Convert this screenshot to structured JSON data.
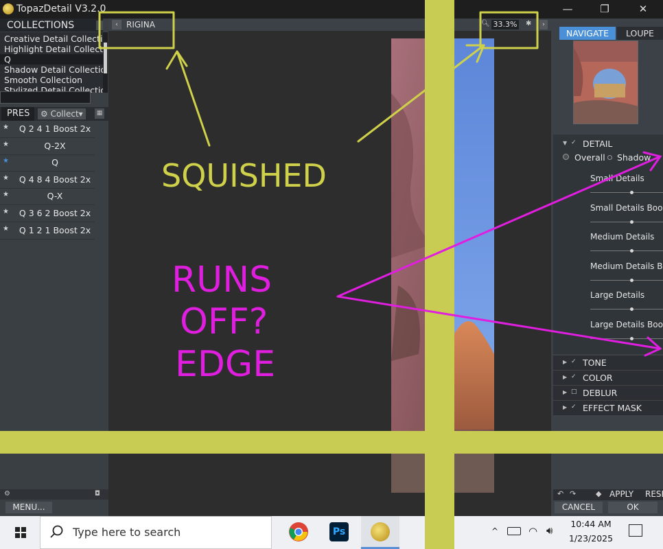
{
  "window": {
    "title": "TopazDetail V3.2.0",
    "controls": {
      "minimize": "—",
      "restore": "❐",
      "close": "✕"
    }
  },
  "collections": {
    "header": "COLLECTIONS",
    "items": [
      "Creative Detail Collection",
      "Highlight Detail Collection",
      "Q",
      "Shadow Detail Collection",
      "Smooth Collection",
      "Stylized Detail Collection"
    ],
    "selected_index": 2
  },
  "presets": {
    "tab_label": "PRES",
    "collect_label": "Collect",
    "items": [
      {
        "label": "Q 2 4 1 Boost 2x",
        "star_color": "#cfd3d7"
      },
      {
        "label": "Q-2X",
        "star_color": "#cfd3d7"
      },
      {
        "label": "Q",
        "star_color": "#4a90d9"
      },
      {
        "label": "Q 4 8 4 Boost 2x",
        "star_color": "#cfd3d7"
      },
      {
        "label": "Q-X",
        "star_color": "#cfd3d7"
      },
      {
        "label": "Q 3 6 2 Boost 2x",
        "star_color": "#cfd3d7"
      },
      {
        "label": "Q 1 2 1 Boost 2x",
        "star_color": "#cfd3d7"
      }
    ]
  },
  "left_footer": {
    "menu_label": "MENU..."
  },
  "toolbar": {
    "view_label": "RIGINA",
    "zoom_value": "33.3%"
  },
  "right_panel": {
    "tabs": {
      "navigate": "NAVIGATE",
      "loupe": "LOUPE"
    },
    "detail": {
      "header": "DETAIL",
      "radio_overall": "Overall",
      "radio_shadow": "Shadow",
      "sliders": [
        {
          "label": "Small Details",
          "value": "0"
        },
        {
          "label": "Small Details Boost",
          "value": "0"
        },
        {
          "label": "Medium Details",
          "value": "0"
        },
        {
          "label": "Medium Details Boost",
          "value": "0"
        },
        {
          "label": "Large Details",
          "value": "0"
        },
        {
          "label": "Large Details Boost",
          "value": "0"
        }
      ]
    },
    "sections": [
      "TONE",
      "COLOR",
      "DEBLUR",
      "EFFECT MASK"
    ],
    "buttons": {
      "apply": "APPLY",
      "reset": "RESET",
      "cancel": "CANCEL",
      "ok": "OK"
    }
  },
  "taskbar": {
    "search_placeholder": "Type here to search",
    "time": "10:44 AM",
    "date": "1/23/2025",
    "apps": [
      "chrome-icon",
      "photoshop-icon",
      "topaz-icon"
    ]
  },
  "annotations": {
    "squished": "SQUISHED",
    "runs_line1": "RUNS",
    "runs_line2": "OFF?",
    "runs_line3": "EDGE",
    "color_yellow": "#cfd14a",
    "color_magenta": "#e01ee0"
  }
}
